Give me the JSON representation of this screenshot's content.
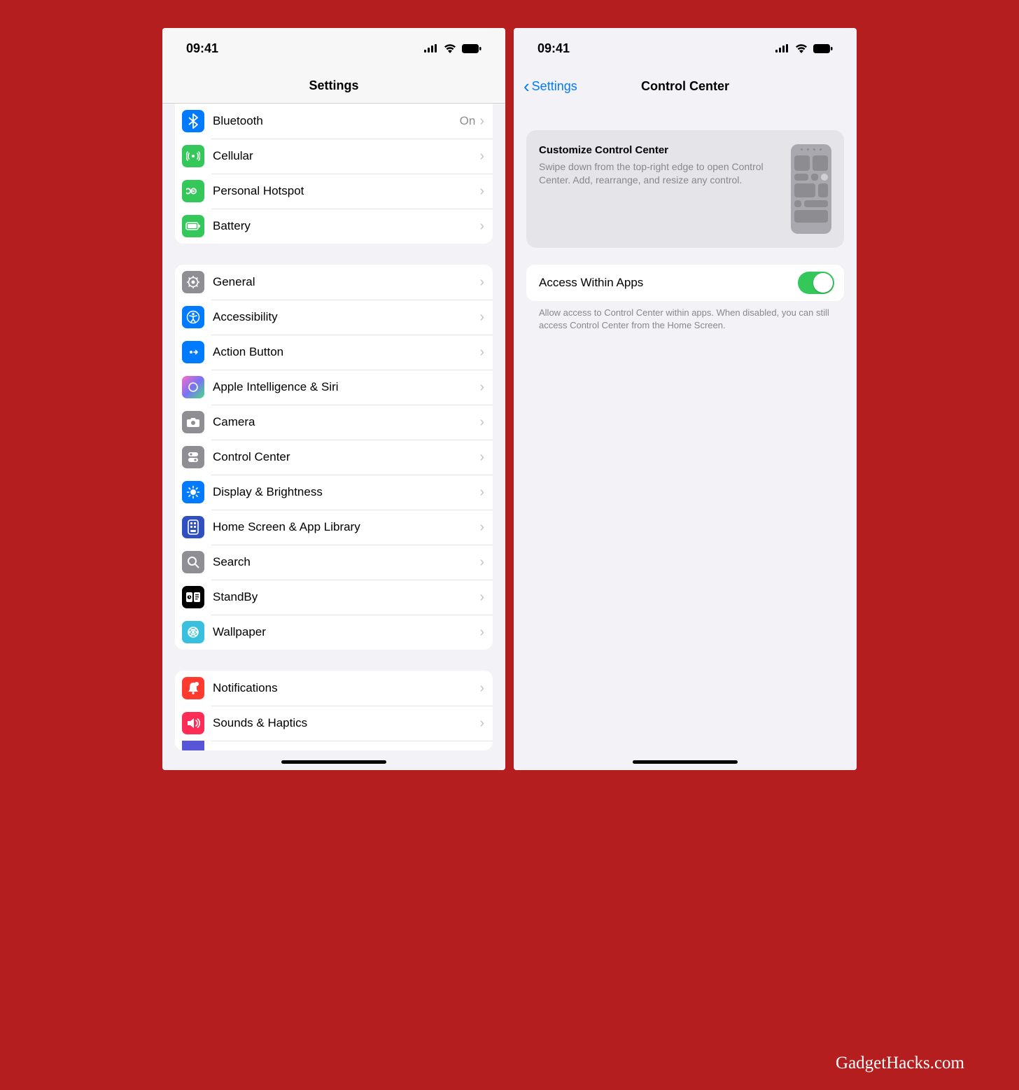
{
  "status": {
    "time": "09:41"
  },
  "left": {
    "title": "Settings",
    "group1": [
      {
        "label": "Bluetooth",
        "detail": "On",
        "iconColor": "#007aff",
        "icon": "bluetooth"
      },
      {
        "label": "Cellular",
        "iconColor": "#34c759",
        "icon": "cellular"
      },
      {
        "label": "Personal Hotspot",
        "iconColor": "#34c759",
        "icon": "hotspot"
      },
      {
        "label": "Battery",
        "iconColor": "#34c759",
        "icon": "battery"
      }
    ],
    "group2": [
      {
        "label": "General",
        "iconColor": "#8e8e93",
        "icon": "gear"
      },
      {
        "label": "Accessibility",
        "iconColor": "#007aff",
        "icon": "accessibility"
      },
      {
        "label": "Action Button",
        "iconColor": "#007aff",
        "icon": "action"
      },
      {
        "label": "Apple Intelligence & Siri",
        "iconColor": "gradient",
        "icon": "siri"
      },
      {
        "label": "Camera",
        "iconColor": "#8e8e93",
        "icon": "camera"
      },
      {
        "label": "Control Center",
        "iconColor": "#8e8e93",
        "icon": "controlcenter"
      },
      {
        "label": "Display & Brightness",
        "iconColor": "#007aff",
        "icon": "brightness"
      },
      {
        "label": "Home Screen & App Library",
        "iconColor": "#2f4db8",
        "icon": "homescreen"
      },
      {
        "label": "Search",
        "iconColor": "#8e8e93",
        "icon": "search"
      },
      {
        "label": "StandBy",
        "iconColor": "#000000",
        "icon": "standby"
      },
      {
        "label": "Wallpaper",
        "iconColor": "#38c0de",
        "icon": "wallpaper"
      }
    ],
    "group3": [
      {
        "label": "Notifications",
        "iconColor": "#ff3b30",
        "icon": "notifications"
      },
      {
        "label": "Sounds & Haptics",
        "iconColor": "#ff2d55",
        "icon": "sounds"
      }
    ]
  },
  "right": {
    "back": "Settings",
    "title": "Control Center",
    "info": {
      "heading": "Customize Control Center",
      "body": "Swipe down from the top-right edge to open Control Center. Add, rearrange, and resize any control."
    },
    "toggle": {
      "label": "Access Within Apps",
      "on": true
    },
    "footer": "Allow access to Control Center within apps. When disabled, you can still access Control Center from the Home Screen."
  },
  "watermark": "GadgetHacks.com"
}
